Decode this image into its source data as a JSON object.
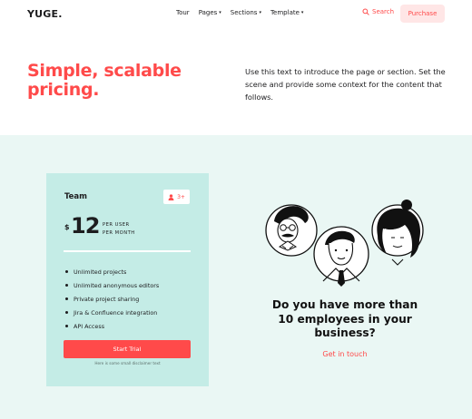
{
  "header": {
    "logo": "YUGE.",
    "nav": [
      {
        "label": "Tour",
        "has_caret": false
      },
      {
        "label": "Pages",
        "has_caret": true
      },
      {
        "label": "Sections",
        "has_caret": true
      },
      {
        "label": "Template",
        "has_caret": true
      }
    ],
    "search_label": "Search",
    "purchase_label": "Purchase"
  },
  "hero": {
    "title_line1": "Simple, scalable",
    "title_line2": "pricing.",
    "intro": "Use this text to introduce the page or section. Set the scene and provide some context for the content that follows."
  },
  "pricing": {
    "plan_name": "Team",
    "seat_badge": "3+",
    "currency": "$",
    "price": "12",
    "unit_line1": "PER USER",
    "unit_line2": "PER MONTH",
    "features": [
      "Unlimited projects",
      "Unlimited anonymous editors",
      "Private project sharing",
      "Jira & Confluence integration",
      "API Access"
    ],
    "cta_label": "Start Trial",
    "disclaimer": "Here is some small disclaimer text"
  },
  "enterprise": {
    "heading_line1": "Do you have more than",
    "heading_line2": "10 employees in your",
    "heading_line3": "business?",
    "link_label": "Get in touch"
  },
  "colors": {
    "accent": "#ff4a4a",
    "mint_bg": "#eaf7f4",
    "card_bg": "#c4ece6"
  },
  "icons": {
    "search": "search-icon",
    "seat": "user-icon",
    "caret": "chevron-down-icon"
  }
}
